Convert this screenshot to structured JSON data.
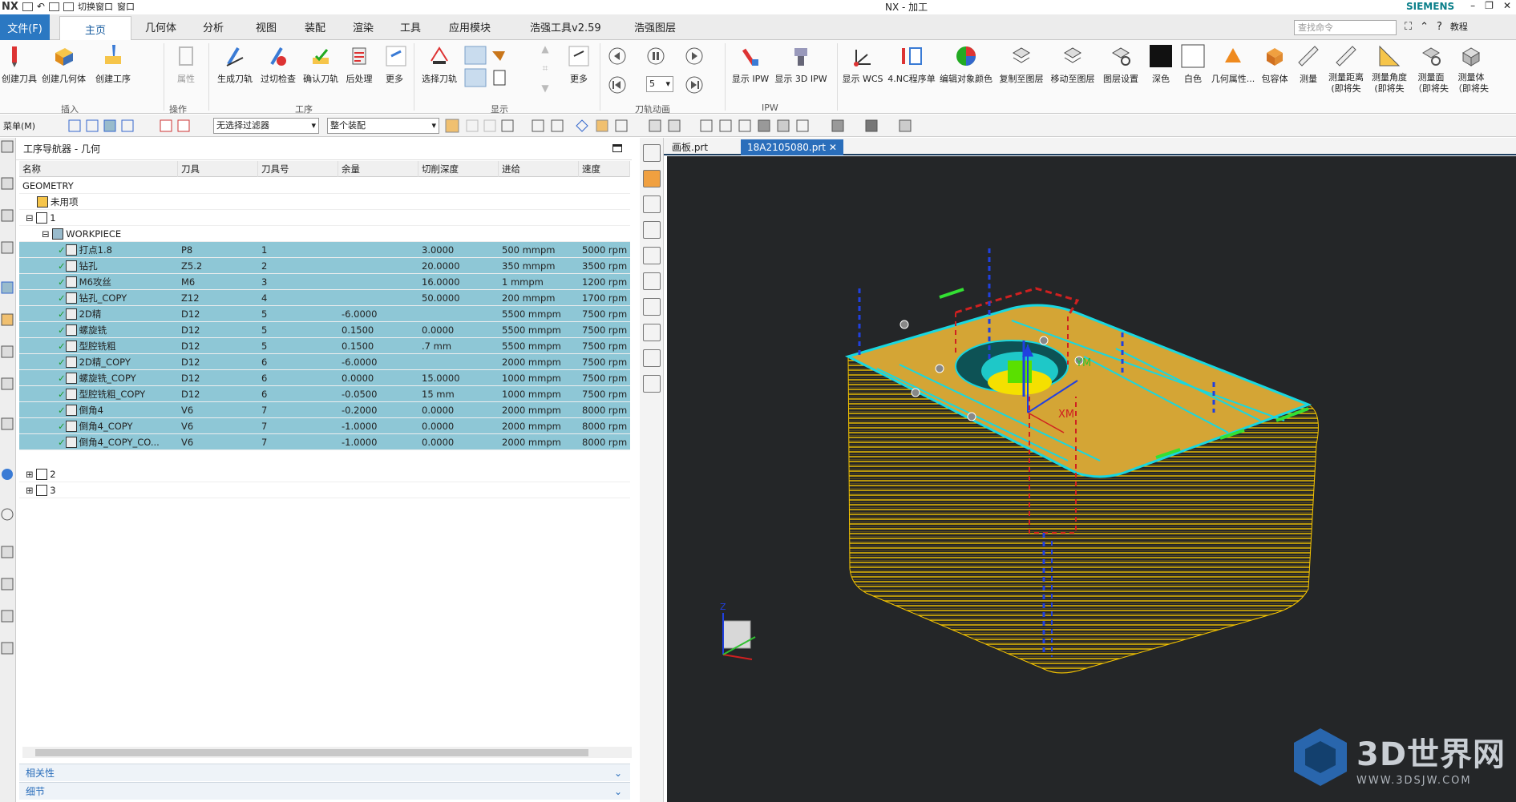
{
  "titlebar": {
    "logo": "NX",
    "switch_window": "切换窗口",
    "window": "窗口",
    "title": "NX - 加工",
    "brand": "SIEMENS"
  },
  "menubar": {
    "file": "文件(F)",
    "items": [
      "主页",
      "几何体",
      "分析",
      "视图",
      "装配",
      "渲染",
      "工具",
      "应用模块",
      "浩强工具v2.59",
      "浩强图层"
    ],
    "search_placeholder": "查找命令",
    "tutorial": "教程"
  },
  "ribbon": {
    "buttons": [
      "创建刀具",
      "创建几何体",
      "创建工序",
      "属性",
      "生成刀轨",
      "过切检查",
      "确认刀轨",
      "后处理",
      "更多",
      "选择刀轨",
      "更多",
      "显示 IPW",
      "显示 3D IPW",
      "显示 WCS",
      "4.NC程序单",
      "编辑对象颜色",
      "复制至图层",
      "移动至图层",
      "图层设置",
      "深色",
      "白色",
      "几何属性...",
      "包容体",
      "测量",
      "测量距离 (即将失",
      "测量角度 (即将失",
      "测量面（即将失",
      "测量体（即将失"
    ],
    "groups": [
      "插入",
      "操作",
      "工序",
      "显示",
      "刀轨动画",
      "IPW"
    ],
    "speed_value": "5"
  },
  "toolbar2": {
    "menu_label": "菜单(M)",
    "filter": "无选择过滤器",
    "assembly": "整个装配"
  },
  "navigator": {
    "title": "工序导航器 - 几何",
    "columns": [
      "名称",
      "刀具",
      "刀具号",
      "余量",
      "切削深度",
      "进给",
      "速度"
    ],
    "geometry_label": "GEOMETRY",
    "unused": "未用项",
    "group1": "1",
    "workpiece": "WORKPIECE",
    "ops": [
      {
        "name": "打点1.8",
        "tool": "P8",
        "num": "1",
        "stock": "",
        "depth": "3.0000",
        "feed": "500 mmpm",
        "speed": "5000 rpm"
      },
      {
        "name": "钻孔",
        "tool": "Z5.2",
        "num": "2",
        "stock": "",
        "depth": "20.0000",
        "feed": "350 mmpm",
        "speed": "3500 rpm"
      },
      {
        "name": "M6攻丝",
        "tool": "M6",
        "num": "3",
        "stock": "",
        "depth": "16.0000",
        "feed": "1 mmpm",
        "speed": "1200 rpm"
      },
      {
        "name": "钻孔_COPY",
        "tool": "Z12",
        "num": "4",
        "stock": "",
        "depth": "50.0000",
        "feed": "200 mmpm",
        "speed": "1700 rpm"
      },
      {
        "name": "2D精",
        "tool": "D12",
        "num": "5",
        "stock": "-6.0000",
        "depth": "",
        "feed": "5500 mmpm",
        "speed": "7500 rpm"
      },
      {
        "name": "螺旋铣",
        "tool": "D12",
        "num": "5",
        "stock": "0.1500",
        "depth": "0.0000",
        "feed": "5500 mmpm",
        "speed": "7500 rpm"
      },
      {
        "name": "型腔铣粗",
        "tool": "D12",
        "num": "5",
        "stock": "0.1500",
        "depth": ".7 mm",
        "feed": "5500 mmpm",
        "speed": "7500 rpm"
      },
      {
        "name": "2D精_COPY",
        "tool": "D12",
        "num": "6",
        "stock": "-6.0000",
        "depth": "",
        "feed": "2000 mmpm",
        "speed": "7500 rpm"
      },
      {
        "name": "螺旋铣_COPY",
        "tool": "D12",
        "num": "6",
        "stock": "0.0000",
        "depth": "15.0000",
        "feed": "1000 mmpm",
        "speed": "7500 rpm"
      },
      {
        "name": "型腔铣粗_COPY",
        "tool": "D12",
        "num": "6",
        "stock": "-0.0500",
        "depth": "15 mm",
        "feed": "1000 mmpm",
        "speed": "7500 rpm"
      },
      {
        "name": "倒角4",
        "tool": "V6",
        "num": "7",
        "stock": "-0.2000",
        "depth": "0.0000",
        "feed": "2000 mmpm",
        "speed": "8000 rpm"
      },
      {
        "name": "倒角4_COPY",
        "tool": "V6",
        "num": "7",
        "stock": "-1.0000",
        "depth": "0.0000",
        "feed": "2000 mmpm",
        "speed": "8000 rpm"
      },
      {
        "name": "倒角4_COPY_CO...",
        "tool": "V6",
        "num": "7",
        "stock": "-1.0000",
        "depth": "0.0000",
        "feed": "2000 mmpm",
        "speed": "8000 rpm"
      }
    ],
    "group2": "2",
    "group3": "3",
    "panel_related": "相关性",
    "panel_detail": "细节"
  },
  "graphics": {
    "tabs": [
      "画板.prt",
      "18A2105080.prt"
    ],
    "axis_ym": "YM",
    "axis_xm": "XM",
    "axis_z": "Z",
    "watermark": "3D世界网",
    "watermark_url": "WWW.3DSJW.COM"
  },
  "colors": {
    "accent": "#2b78c2",
    "selection": "#8ec7d6",
    "viewport": "#242628",
    "toolpath": "#f5c400",
    "cyan": "#19d7e0"
  }
}
